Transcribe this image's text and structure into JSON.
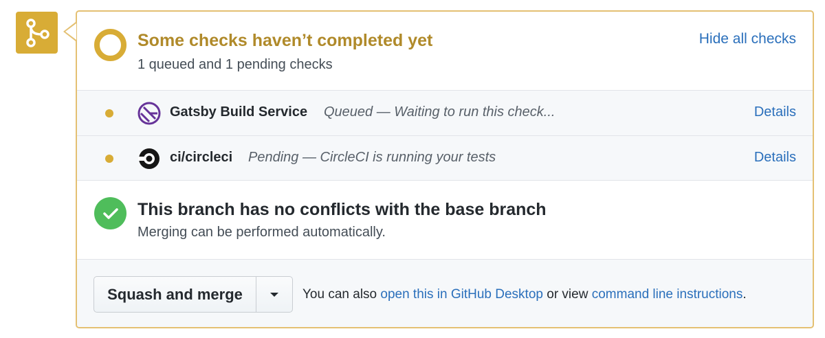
{
  "status": {
    "title": "Some checks haven’t completed yet",
    "subtitle": "1 queued and 1 pending checks",
    "hide_link": "Hide all checks"
  },
  "checks": [
    {
      "name": "Gatsby Build Service",
      "description": "Queued — Waiting to run this check...",
      "details": "Details",
      "state": "queued",
      "icon": "gatsby-logo-icon"
    },
    {
      "name": "ci/circleci",
      "description": "Pending — CircleCI is running your tests",
      "details": "Details",
      "state": "pending",
      "icon": "circleci-logo-icon"
    }
  ],
  "merge": {
    "title": "This branch has no conflicts with the base branch",
    "subtitle": "Merging can be performed automatically."
  },
  "actions": {
    "merge_button": "Squash and merge",
    "also_prefix": "You can also",
    "desktop_link": "open this in GitHub Desktop",
    "or_view": "or view",
    "cli_link": "command line instructions",
    "period": "."
  },
  "colors": {
    "pending": "#d8ac36",
    "success": "#4fbd5b",
    "link": "#2a6fbb",
    "gatsby": "#663399"
  }
}
